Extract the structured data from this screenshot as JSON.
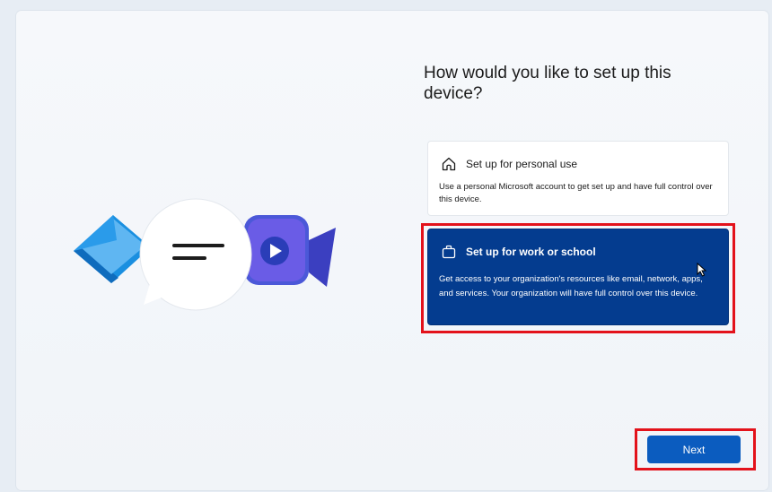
{
  "page": {
    "title": "How would you like to set up this device?"
  },
  "options": [
    {
      "label": "Set up for personal use",
      "description": "Use a personal Microsoft account to get set up and have full control over this device.",
      "icon": "home-icon",
      "selected": false
    },
    {
      "label": "Set up for work or school",
      "description": "Get access to your organization's resources like email, network, apps, and services. Your organization will have full control over this device.",
      "icon": "briefcase-icon",
      "selected": true
    }
  ],
  "footer": {
    "next_label": "Next"
  },
  "illustration": {
    "icons": [
      "mail-icon",
      "chat-bubble-icon",
      "video-camera-icon"
    ]
  },
  "colors": {
    "selected_card": "#043c8f",
    "accent_button": "#0b5cbf",
    "highlight": "#e3121b"
  }
}
